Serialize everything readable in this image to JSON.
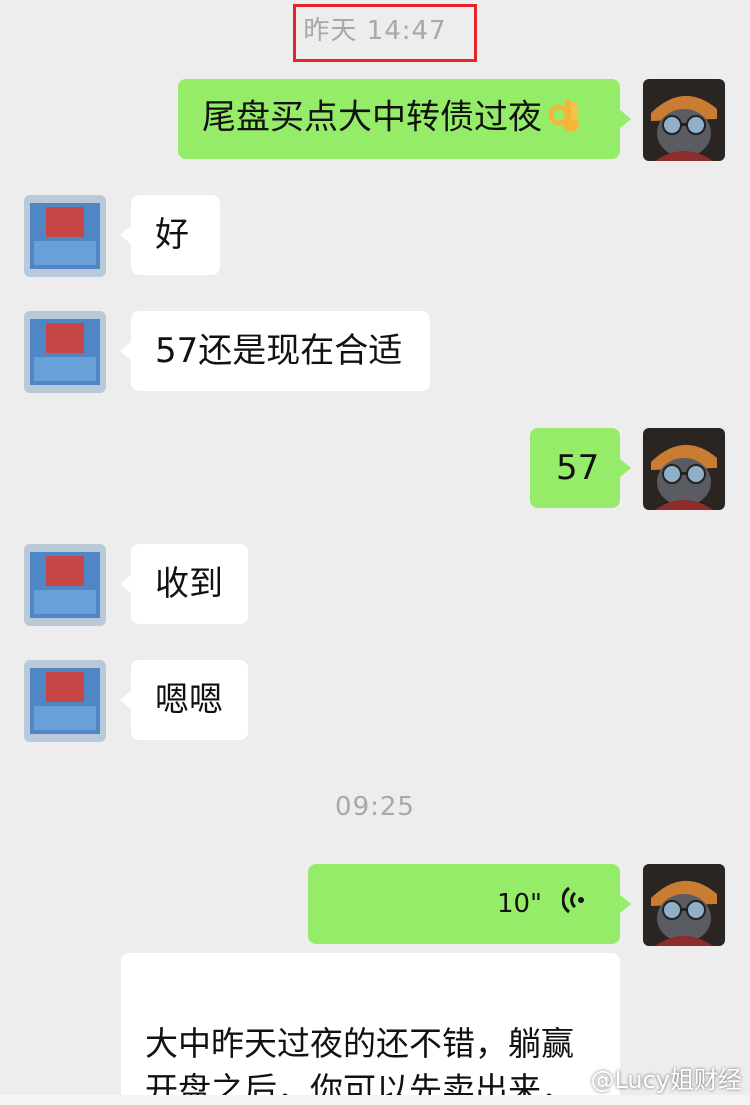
{
  "chat": {
    "timestamps": [
      "昨天 14:47",
      "09:25"
    ],
    "messages": [
      {
        "side": "out",
        "text": "尾盘买点大中转债过夜",
        "emoji": "ok-hand-icon"
      },
      {
        "side": "in",
        "text": "好"
      },
      {
        "side": "in",
        "text": "57还是现在合适"
      },
      {
        "side": "out",
        "text": "57"
      },
      {
        "side": "in",
        "text": "收到"
      },
      {
        "side": "in",
        "text": "嗯嗯"
      },
      {
        "side": "out",
        "type": "voice",
        "duration": "10\""
      }
    ],
    "transcript": "大中昨天过夜的还不错，躺赢\n开盘之后，你可以先卖出来，\n好吧，高开五六个点。"
  },
  "watermark": "@Lucy姐财经",
  "colors": {
    "background": "#ededed",
    "outgoing_bubble": "#95ec69",
    "incoming_bubble": "#ffffff",
    "highlight_box": "#e8222a"
  }
}
